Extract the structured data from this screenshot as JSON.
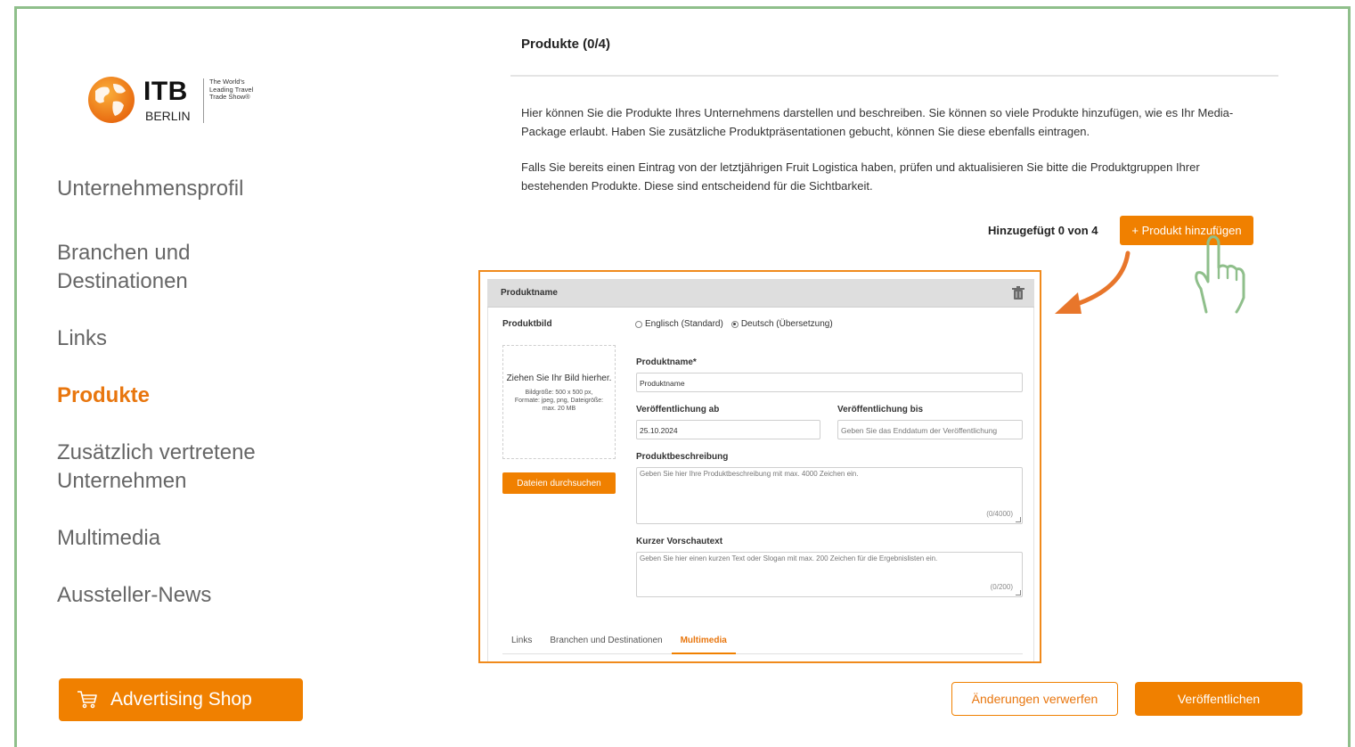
{
  "logo": {
    "name": "ITB",
    "sub": "BERLIN",
    "tagline": "The World's Leading Travel Trade Show®"
  },
  "sidebar": {
    "items": [
      {
        "label": "Unternehmensprofil",
        "active": false
      },
      {
        "label": "Branchen und Destinationen",
        "active": false
      },
      {
        "label": "Links",
        "active": false
      },
      {
        "label": "Produkte",
        "active": true
      },
      {
        "label": "Zusätzlich vertretene Unternehmen",
        "active": false
      },
      {
        "label": "Multimedia",
        "active": false
      },
      {
        "label": "Aussteller-News",
        "active": false
      }
    ],
    "advertising_shop": "Advertising Shop",
    "shop_icon": "cart-icon"
  },
  "main": {
    "title": "Produkte (0/4)",
    "paragraph1": "Hier können Sie die Produkte Ihres Unternehmens darstellen und beschreiben. Sie können so viele Produkte hinzufügen, wie es Ihr Media-Package erlaubt. Haben Sie zusätzliche Produktpräsentationen gebucht, können Sie diese ebenfalls eintragen.",
    "paragraph2": "Falls Sie bereits einen Eintrag von der letztjährigen Fruit Logistica haben, prüfen und aktualisieren Sie bitte die Produktgruppen Ihrer bestehenden Produkte. Diese sind entscheidend für die Sichtbarkeit.",
    "added_count": "Hinzugefügt 0 von 4",
    "add_button": "+ Produkt hinzufügen"
  },
  "card": {
    "header": "Produktname",
    "image_label": "Produktbild",
    "lang_en": "Englisch (Standard)",
    "lang_de": "Deutsch (Übersetzung)",
    "selected_lang": "de",
    "drop_title": "Ziehen Sie Ihr Bild hierher.",
    "drop_info": "Bildgröße: 500 x 500 px, Formate: jpeg, png, Dateigröße: max. 20 MB",
    "browse_button": "Dateien durchsuchen",
    "name_label": "Produktname*",
    "name_value": "Produktname",
    "pub_from_label": "Veröffentlichung ab",
    "pub_from_value": "25.10.2024",
    "pub_to_label": "Veröffentlichung bis",
    "pub_to_placeholder": "Geben Sie das Enddatum der Veröffentlichung",
    "desc_label": "Produktbeschreibung",
    "desc_placeholder": "Geben Sie hier Ihre Produktbeschreibung mit max. 4000 Zeichen ein.",
    "desc_counter": "(0/4000)",
    "short_label": "Kurzer Vorschautext",
    "short_placeholder": "Geben Sie hier einen kurzen Text oder Slogan mit max. 200 Zeichen für die Ergebnislisten ein.",
    "short_counter": "(0/200)",
    "tabs": [
      {
        "label": "Links",
        "active": false
      },
      {
        "label": "Branchen und Destinationen",
        "active": false
      },
      {
        "label": "Multimedia",
        "active": true
      }
    ]
  },
  "footer": {
    "discard": "Änderungen verwerfen",
    "publish": "Veröffentlichen"
  },
  "colors": {
    "accent": "#f08000",
    "frame": "#8fbf8b",
    "hand": "#8fbf8b",
    "arrow": "#e8762b"
  }
}
